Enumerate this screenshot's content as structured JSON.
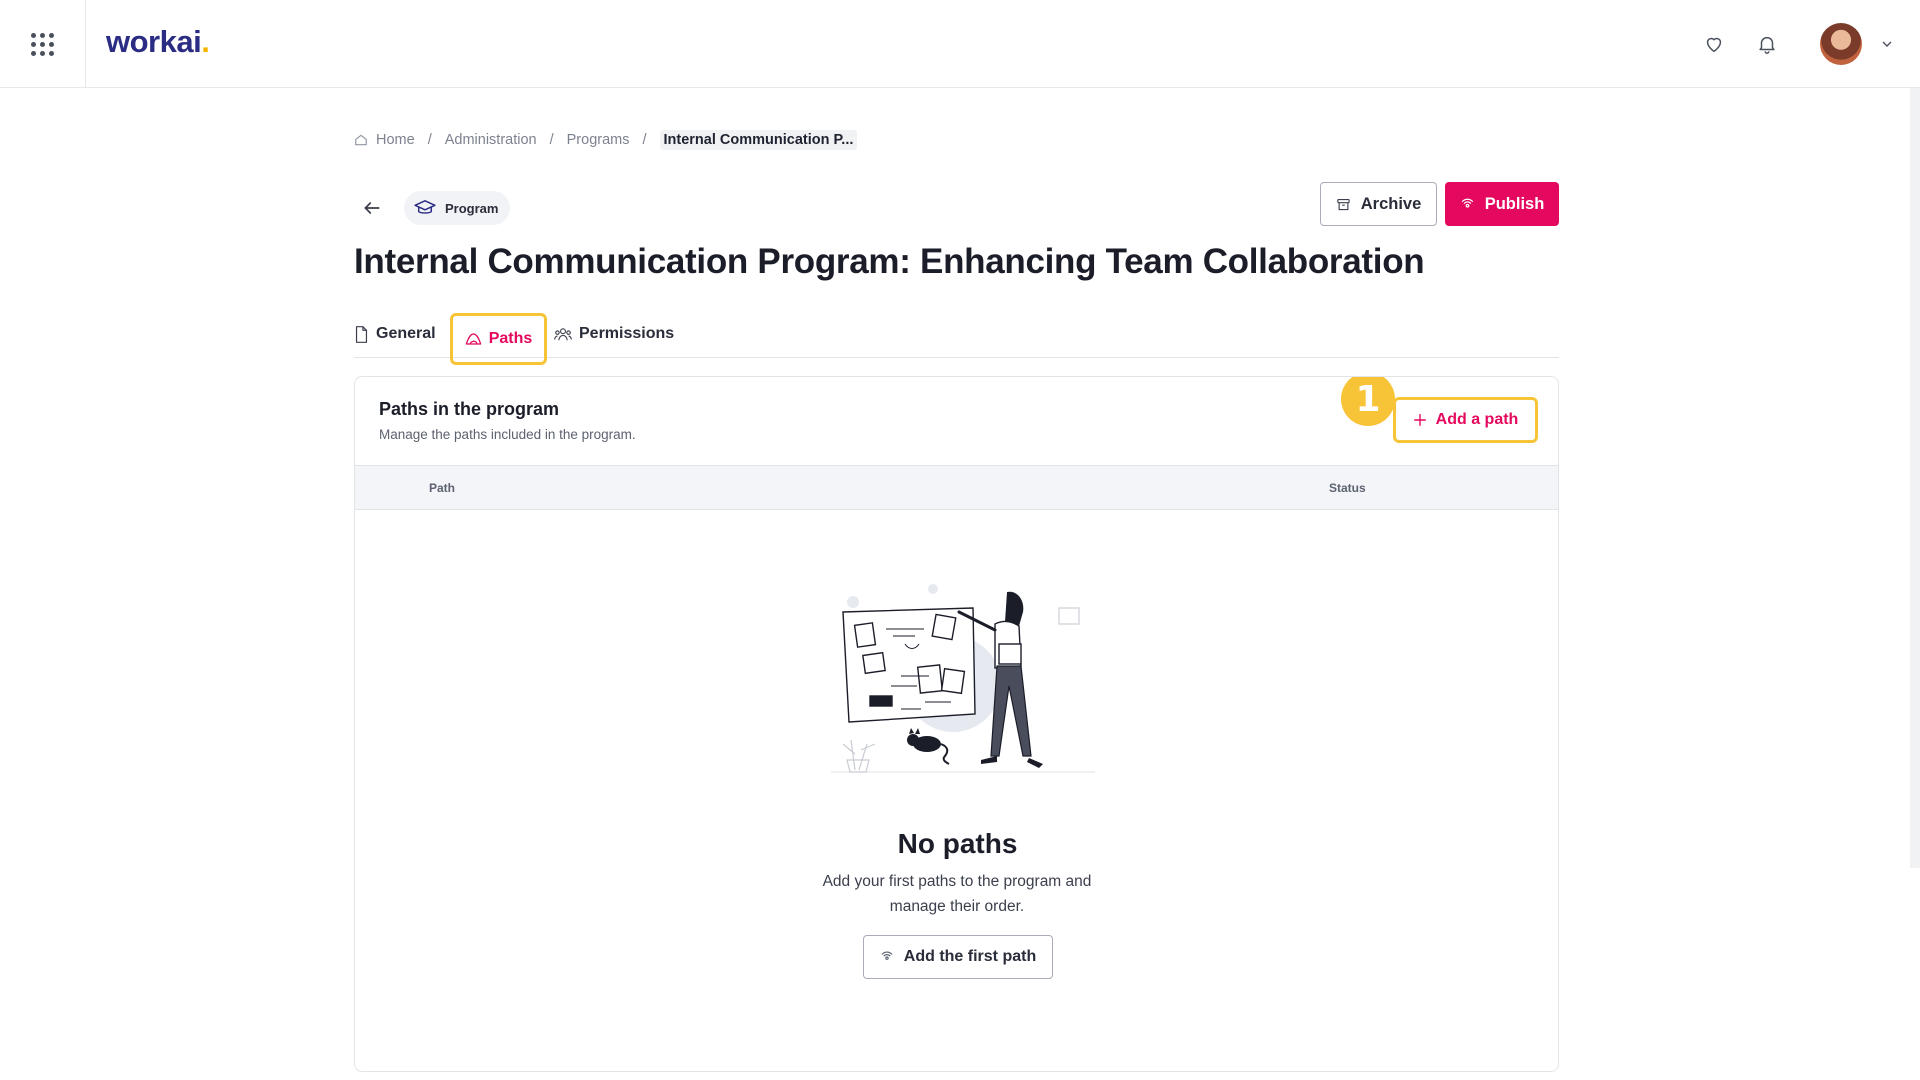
{
  "app": {
    "logo_text": "workai",
    "logo_dot": "."
  },
  "topbar": {
    "icons": [
      "apps-grid-icon",
      "heart-icon",
      "bell-icon",
      "chevron-down-icon"
    ]
  },
  "breadcrumb": {
    "items": [
      "Home",
      "Administration",
      "Programs"
    ],
    "current": "Internal Communication P...",
    "separator": "/"
  },
  "header": {
    "type_label": "Program",
    "archive_label": "Archive",
    "publish_label": "Publish",
    "title": "Internal Communication Program: Enhancing Team Collaboration"
  },
  "tabs": [
    {
      "label": "General",
      "active": false
    },
    {
      "label": "Paths",
      "active": true
    },
    {
      "label": "Permissions",
      "active": false
    }
  ],
  "panel": {
    "title": "Paths in the program",
    "subtitle": "Manage the paths included in the program.",
    "step_number": "1",
    "add_path_label": "Add a path",
    "columns": [
      "Path",
      "Status"
    ],
    "empty": {
      "title": "No paths",
      "description": "Add your first paths to the program and manage their order.",
      "button_label": "Add the first path"
    }
  },
  "colors": {
    "accent": "#e4085e",
    "highlight": "#f8c437",
    "logo": "#2b2d84"
  }
}
